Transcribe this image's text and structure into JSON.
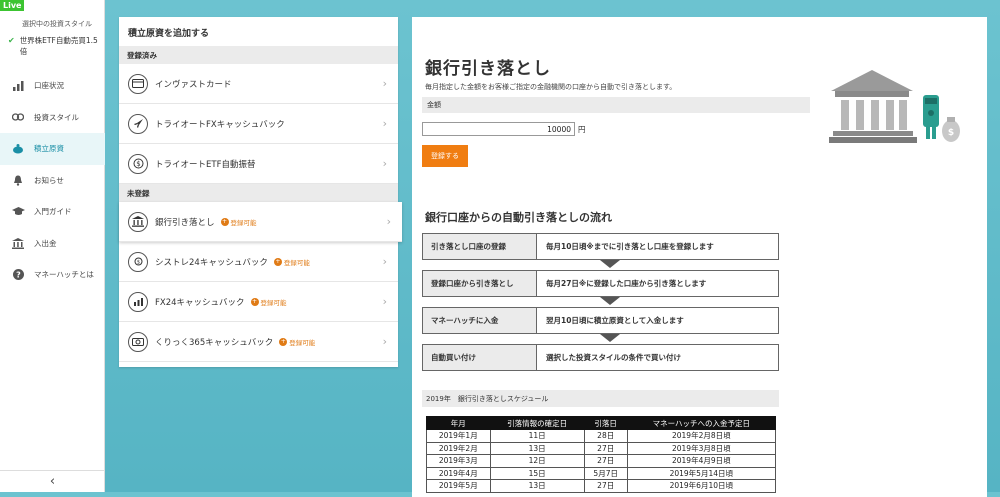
{
  "live_badge": "Live",
  "sidebar": {
    "style_label": "選択中の投資スタイル",
    "style_value": "世界株ETF自動売買1.5倍",
    "items": [
      {
        "label": "口座状況",
        "icon": "bar-chart-icon"
      },
      {
        "label": "投資スタイル",
        "icon": "style-icon"
      },
      {
        "label": "積立原資",
        "icon": "piggy-bank-icon"
      },
      {
        "label": "お知らせ",
        "icon": "bell-icon"
      },
      {
        "label": "入門ガイド",
        "icon": "graduation-cap-icon"
      },
      {
        "label": "入出金",
        "icon": "bank-icon"
      },
      {
        "label": "マネーハッチとは",
        "icon": "question-icon"
      }
    ],
    "collapse": "‹"
  },
  "left_panel": {
    "title": "積立原資を追加する",
    "registered_label": "登録済み",
    "registered": [
      {
        "label": "インヴァストカード",
        "icon": "card-icon"
      },
      {
        "label": "トライオートFXキャッシュバック",
        "icon": "rocket-icon"
      },
      {
        "label": "トライオートETF自動振替",
        "icon": "coin-icon"
      }
    ],
    "unregistered_label": "未登録",
    "unregistered": [
      {
        "label": "銀行引き落とし",
        "badge": "登録可能",
        "icon": "bank-icon"
      },
      {
        "label": "シストレ24キャッシュバック",
        "badge": "登録可能",
        "icon": "refresh-icon"
      },
      {
        "label": "FX24キャッシュバック",
        "badge": "登録可能",
        "icon": "chart-up-icon"
      },
      {
        "label": "くりっく365キャッシュバック",
        "badge": "登録可能",
        "icon": "money-icon"
      }
    ]
  },
  "right_panel": {
    "title": "銀行引き落とし",
    "description": "毎月指定した金額をお客様ご指定の金融機関の口座から自動で引き落とします。",
    "amount_label": "金額",
    "amount_value": "10000",
    "amount_unit": "円",
    "register_button": "登録する",
    "flow_title": "銀行口座からの自動引き落としの流れ",
    "flow": [
      {
        "step": "引き落とし口座の登録",
        "desc": "毎月10日頃※までに引き落とし口座を登録します"
      },
      {
        "step": "登録口座から引き落とし",
        "desc": "毎月27日※に登録した口座から引き落とします"
      },
      {
        "step": "マネーハッチに入金",
        "desc": "翌月10日頃に積立原資として入金します"
      },
      {
        "step": "自動買い付け",
        "desc": "選択した投資スタイルの条件で買い付け"
      }
    ],
    "schedule_label": "2019年　銀行引き落としスケジュール",
    "schedule_headers": [
      "年月",
      "引落情報の確定日",
      "引落日",
      "マネーハッチへの入金予定日"
    ],
    "schedule_rows": [
      [
        "2019年1月",
        "11日",
        "28日",
        "2019年2月8日頃"
      ],
      [
        "2019年2月",
        "13日",
        "27日",
        "2019年3月8日頃"
      ],
      [
        "2019年3月",
        "12日",
        "27日",
        "2019年4月9日頃"
      ],
      [
        "2019年4月",
        "15日",
        "5月7日",
        "2019年5月14日頃"
      ],
      [
        "2019年5月",
        "13日",
        "27日",
        "2019年6月10日頃"
      ]
    ]
  },
  "colors": {
    "accent": "#f07d11",
    "teal": "#5bb7c6",
    "live": "#3cc431",
    "badge": "#e07b16"
  }
}
